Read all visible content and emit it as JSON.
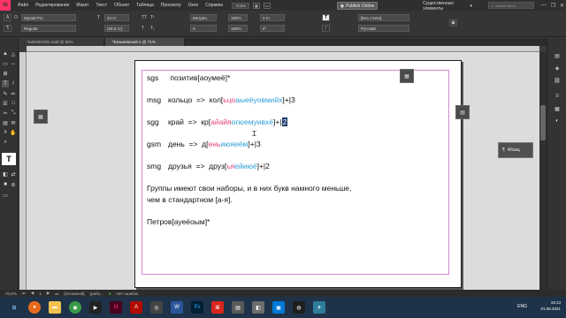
{
  "menubar": {
    "logo": "Id",
    "items": [
      "Файл",
      "Редактирование",
      "Макет",
      "Текст",
      "Объект",
      "Таблица",
      "Просмотр",
      "Окно",
      "Справка"
    ],
    "zoom": "70,6%",
    "publish_label": "Publish Online",
    "workspace": "Существенные элементы",
    "stock_search_placeholder": "Adobe Stock"
  },
  "control": {
    "font_family": "Myriad Pro",
    "font_style": "Regular",
    "font_size": "24 пт",
    "leading": "(28,8 пт)",
    "kerning": "Метрич.",
    "tracking": "0",
    "scale_v": "100%",
    "scale_h": "100%",
    "baseline": "0 пт",
    "skew": "0°",
    "char_style": "[Без стиля]",
    "language": "Русский"
  },
  "tabs": [
    {
      "label": "*Indes\\Id-801.indd @ 85%",
      "active": false
    },
    {
      "label": "*Безымянный-1 @ 71%",
      "active": true
    }
  ],
  "document": {
    "lines": [
      {
        "code": "sgs",
        "text": "позитив[аоумеё]*"
      },
      {
        "code": "msg",
        "pre": "кольцо  =>  кол[",
        "pink": "ьцо",
        "blue": "аыеёуовмийх",
        "post": "]+|3"
      },
      {
        "code": "sgg",
        "pre": "край  =>  кр[",
        "pink": "айайя",
        "blue": "огюемуивхё",
        "post": "]+|",
        "sel": "2"
      },
      {
        "code": "gsm",
        "pre": "день  =>  д[",
        "pink": "ень",
        "blue": "июяеём",
        "post": "]+|3"
      },
      {
        "code": "smg",
        "pre": "друзья  =>  друз[",
        "pink": "ья",
        "blue": "ейиюё",
        "post": "]+|2"
      }
    ],
    "paragraph_line1": "Группы имеют свои наборы, и в них букв намного меньше,",
    "paragraph_line2": "чем в стандартном [а-я].",
    "last_line": "Петров[ауеёоым]*"
  },
  "panel": {
    "abzac_label": "Абзац"
  },
  "statusbar": {
    "zoom": "70,6%",
    "page": "1",
    "style": "[Основной]",
    "mode": "(рабо...",
    "errors": "Нет ошибок"
  },
  "taskbar": {
    "lang": "ENG",
    "time": "19:13",
    "date": "01.06.2021"
  },
  "colors": {
    "pink_hl": "#e0447a",
    "blue_hl": "#2f9fd8",
    "margin_guide": "#d28ad2"
  }
}
